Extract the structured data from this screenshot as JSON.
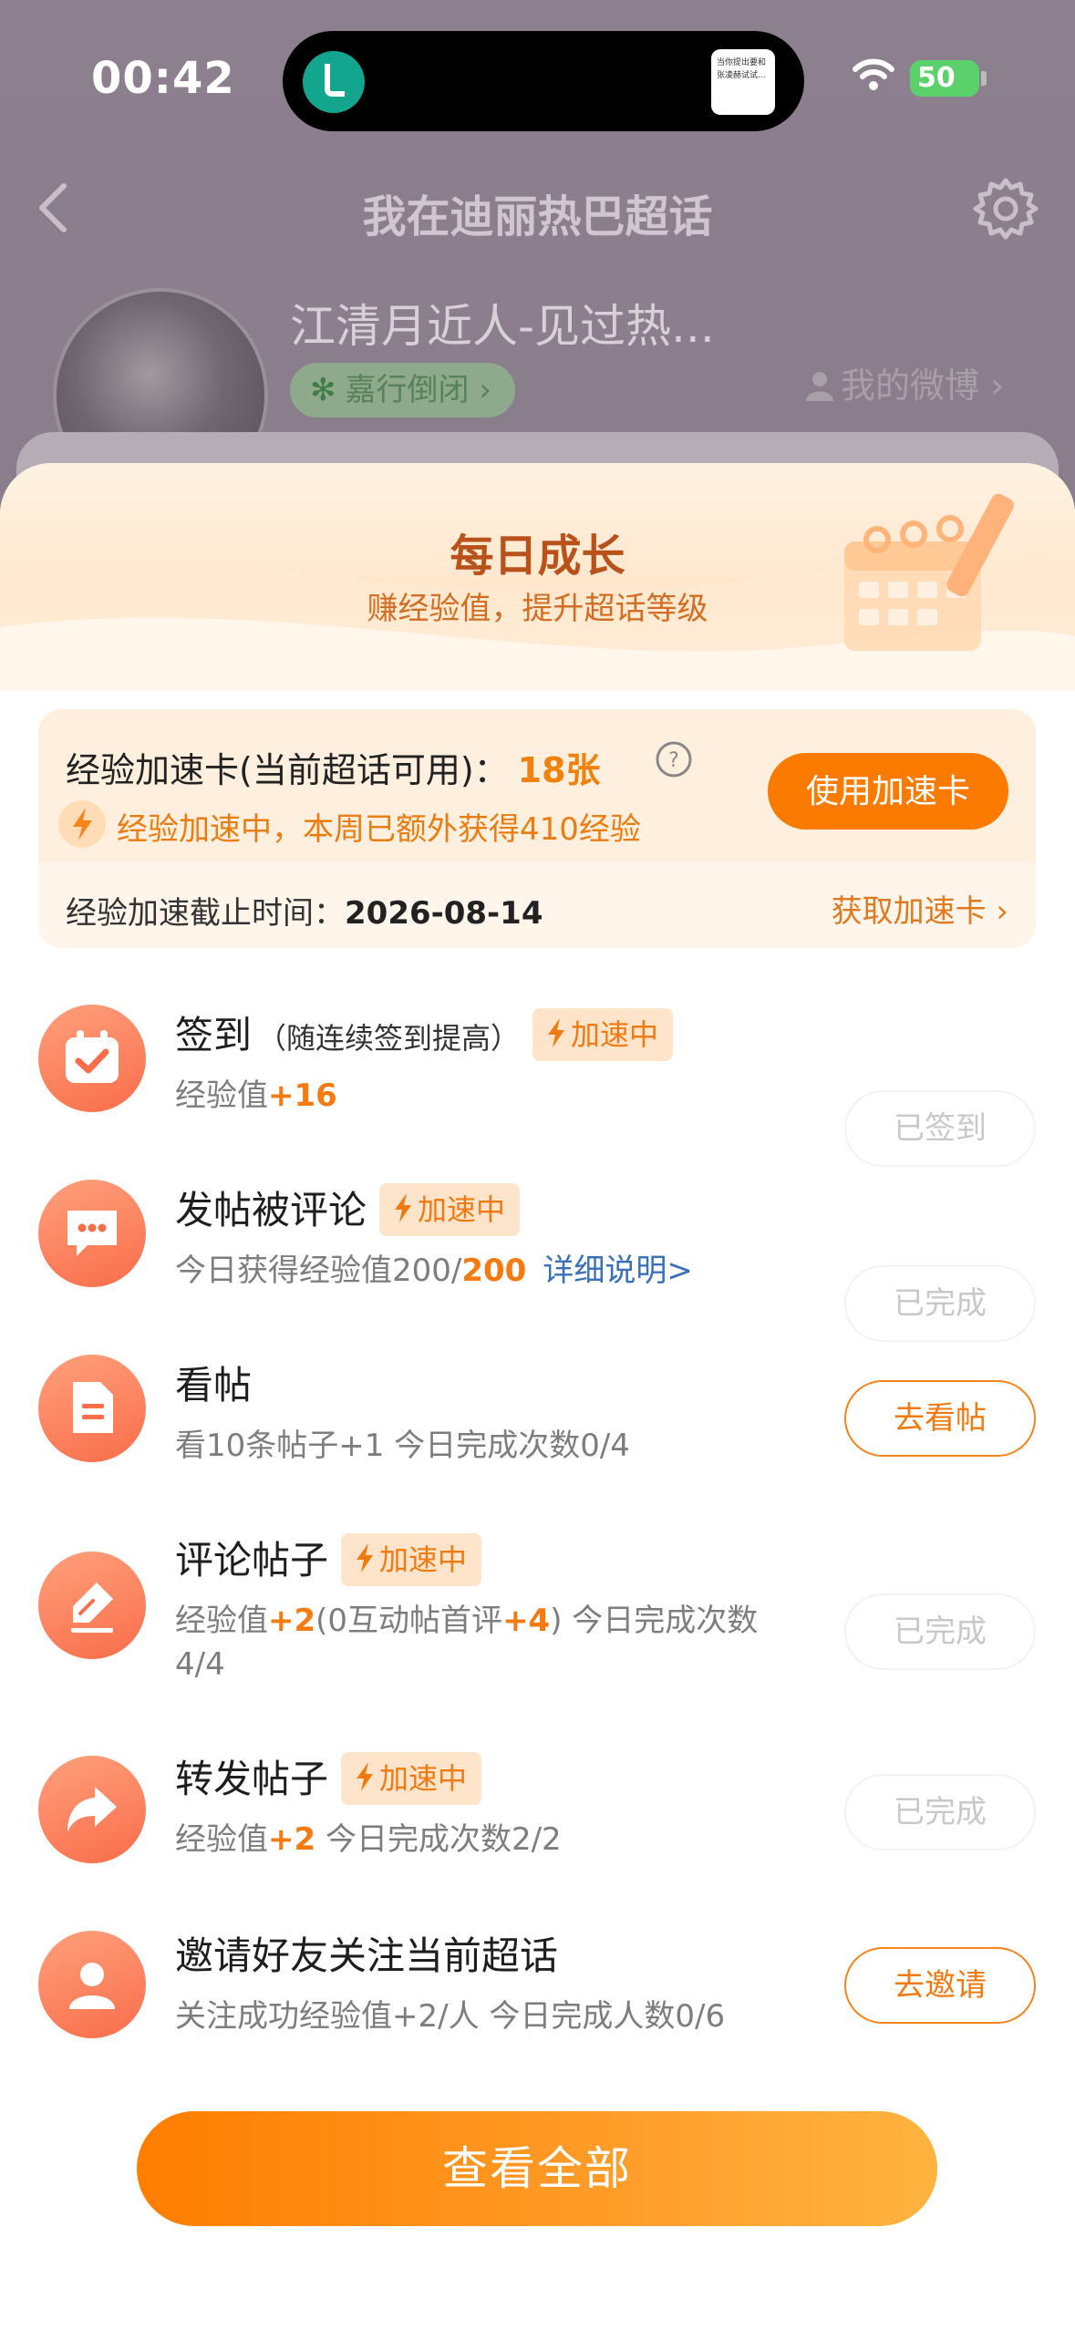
{
  "status_bar": {
    "time": "00:42",
    "battery": "50",
    "island_text": "当你提出要和张凌赫试试..."
  },
  "page": {
    "title": "我在迪丽热巴超话"
  },
  "profile": {
    "name": "江清月近人-见过热...",
    "tag": "嘉行倒闭",
    "tag_arrow": "›",
    "my_weibo": "我的微博 ›"
  },
  "sheet": {
    "title": "每日成长",
    "subtitle": "赚经验值，提升超话等级",
    "speed_card": {
      "label": "经验加速卡(当前超话可用)：",
      "count": "18张",
      "status": "经验加速中，本周已额外获得410经验",
      "use_button": "使用加速卡",
      "deadline_label": "经验加速截止时间：",
      "deadline_value": "2026-08-14",
      "get_link": "获取加速卡 ›"
    },
    "speed_tag": "加速中",
    "tasks": [
      {
        "title": "签到",
        "note": "（随连续签到提高）",
        "desc_prefix": "经验值",
        "desc_hl": "+16",
        "button": "已签到"
      },
      {
        "title": "发帖被评论",
        "desc_prefix": "今日获得经验值200/",
        "desc_hl": "200",
        "link": "详细说明>",
        "button": "已完成"
      },
      {
        "title": "看帖",
        "desc": "看10条帖子+1   今日完成次数0/4",
        "button": "去看帖"
      },
      {
        "title": "评论帖子",
        "desc_a": "经验值",
        "desc_hl1": "+2",
        "desc_b": "(0互动帖首评",
        "desc_hl2": "+4",
        "desc_c": ")   今日完成次数",
        "desc_line2": "4/4",
        "button": "已完成"
      },
      {
        "title": "转发帖子",
        "desc_a": "经验值",
        "desc_hl": "+2",
        "desc_b": "   今日完成次数2/2",
        "button": "已完成"
      },
      {
        "title": "邀请好友关注当前超话",
        "desc": "关注成功经验值+2/人   今日完成人数0/6",
        "button": "去邀请"
      }
    ],
    "view_all": "查看全部"
  },
  "colors": {
    "accent": "#FB7A00",
    "highlight": "#F57A10",
    "link": "#3970B8",
    "task_icon": "#FA6D4A"
  },
  "icons": [
    "back-icon",
    "gear-icon",
    "help-icon",
    "bolt-icon",
    "calendar-check-icon",
    "chat-bubble-icon",
    "document-icon",
    "edit-icon",
    "share-arrow-icon",
    "person-icon",
    "wifi-icon",
    "battery-icon"
  ]
}
